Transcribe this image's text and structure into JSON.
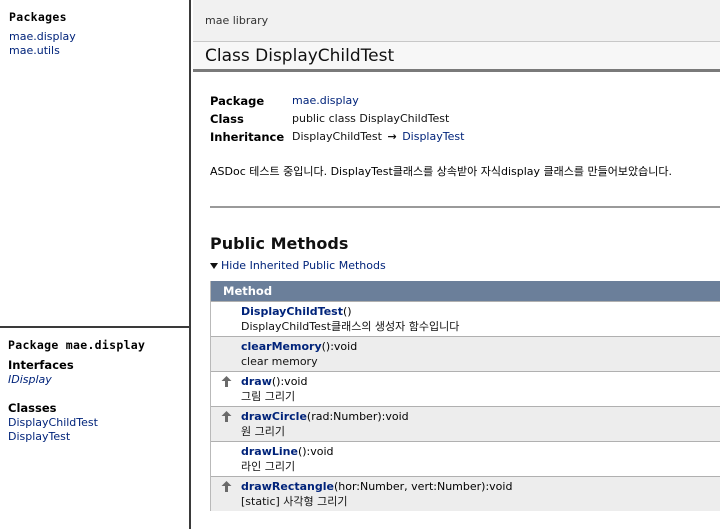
{
  "packages_frame": {
    "heading": "Packages",
    "items": [
      "mae.display",
      "mae.utils"
    ]
  },
  "package_frame": {
    "heading": "Package mae.display",
    "interfaces_label": "Interfaces",
    "interfaces": [
      "IDisplay"
    ],
    "classes_label": "Classes",
    "classes": [
      "DisplayChildTest",
      "DisplayTest"
    ]
  },
  "header": {
    "library_title": "mae library",
    "class_title": "Class DisplayChildTest"
  },
  "meta": {
    "package_label": "Package",
    "package_value": "mae.display",
    "class_label": "Class",
    "class_value": "public class DisplayChildTest",
    "inheritance_label": "Inheritance",
    "inheritance_from": "DisplayChildTest",
    "inheritance_arrow": "→",
    "inheritance_to": "DisplayTest"
  },
  "description": "ASDoc 테스트 중입니다. DisplayTest클래스를 상속받아 자식display 클래스를 만들어보았습니다.",
  "public_methods": {
    "heading": "Public Methods",
    "toggle_label": "Hide Inherited Public Methods",
    "column_header": "Method",
    "rows": [
      {
        "name": "DisplayChildTest",
        "params": "()",
        "desc": "DisplayChildTest클래스의 생성자 함수입니다",
        "inherited": false
      },
      {
        "name": "clearMemory",
        "params": "():void",
        "desc": "clear memory",
        "inherited": false
      },
      {
        "name": "draw",
        "params": "():void",
        "desc": "그림 그리기",
        "inherited": true
      },
      {
        "name": "drawCircle",
        "params": "(rad:Number):void",
        "desc": "원 그리기",
        "inherited": true
      },
      {
        "name": "drawLine",
        "params": "():void",
        "desc": "라인 그리기",
        "inherited": false
      },
      {
        "name": "drawRectangle",
        "params": "(hor:Number, vert:Number):void",
        "desc": "[static] 사각형 그리기",
        "inherited": true
      }
    ]
  },
  "icons": {
    "inherited": "up-arrow-icon",
    "toggle": "triangle-down-icon"
  },
  "colors": {
    "link": "#00237a",
    "table_header": "#6b7f9a",
    "alt_row": "#ededed"
  }
}
